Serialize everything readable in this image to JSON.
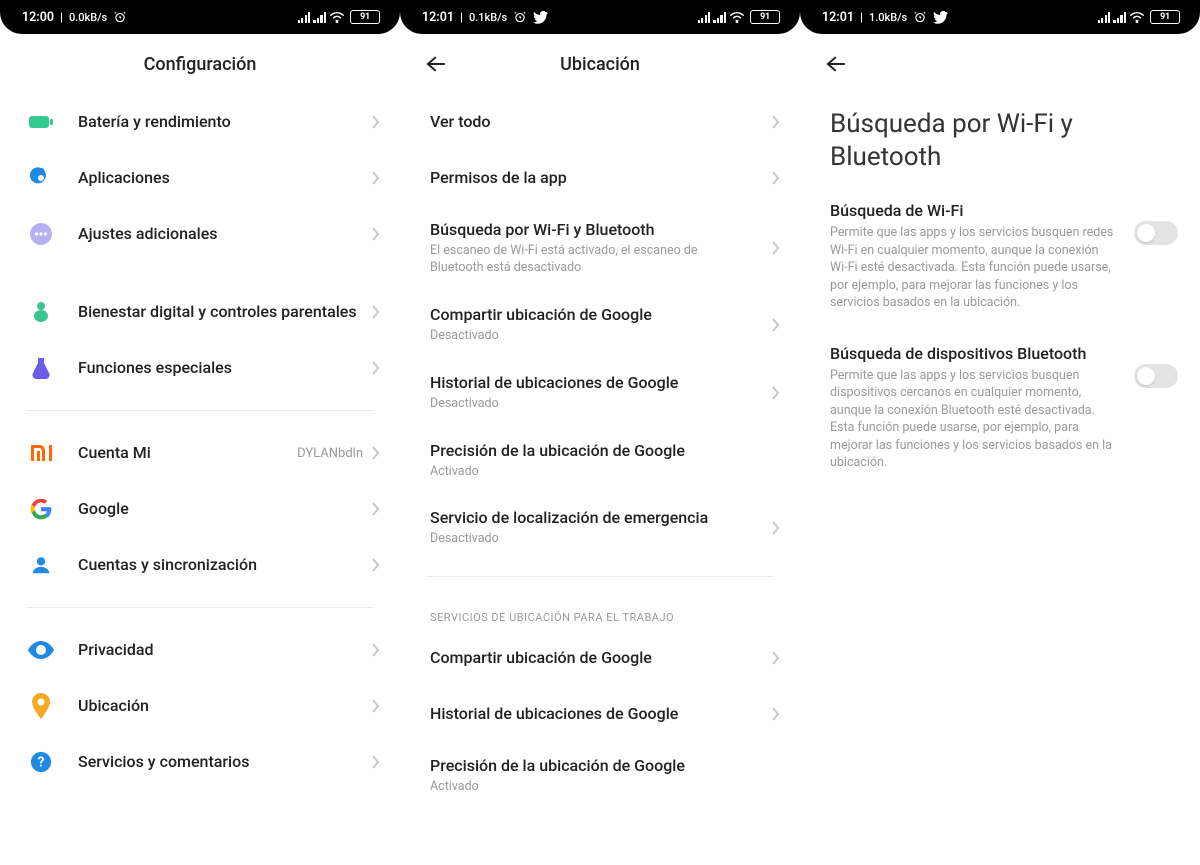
{
  "phones": [
    {
      "status": {
        "time": "12:00",
        "kbs": "0.0kB/s",
        "battery": "91",
        "twitter": false
      },
      "title": "Configuración",
      "groups": [
        {
          "type": "items",
          "items": [
            {
              "icon": "battery",
              "label": "Batería y rendimiento"
            },
            {
              "icon": "apps",
              "label": "Aplicaciones"
            },
            {
              "icon": "dots",
              "label": "Ajustes adicionales"
            }
          ]
        },
        {
          "type": "items",
          "items": [
            {
              "icon": "wellbeing",
              "label": "Bienestar digital y controles parentales"
            },
            {
              "icon": "special",
              "label": "Funciones especiales"
            }
          ]
        },
        {
          "type": "divider"
        },
        {
          "type": "items",
          "items": [
            {
              "icon": "mi",
              "label": "Cuenta Mi",
              "value": "DYLANbdln"
            },
            {
              "icon": "google",
              "label": "Google"
            },
            {
              "icon": "person",
              "label": "Cuentas y sincronización"
            }
          ]
        },
        {
          "type": "divider"
        },
        {
          "type": "items",
          "items": [
            {
              "icon": "eye",
              "label": "Privacidad"
            },
            {
              "icon": "location",
              "label": "Ubicación"
            },
            {
              "icon": "help",
              "label": "Servicios y comentarios"
            }
          ]
        }
      ]
    },
    {
      "status": {
        "time": "12:01",
        "kbs": "0.1kB/s",
        "battery": "91",
        "twitter": true
      },
      "back": true,
      "title": "Ubicación",
      "groups": [
        {
          "type": "plain",
          "items": [
            {
              "label": "Ver todo"
            },
            {
              "label": "Permisos de la app"
            },
            {
              "label": "Búsqueda por Wi-Fi y Bluetooth",
              "sub": "El escaneo de Wi-Fi está activado, el escaneo de Bluetooth está desactivado"
            },
            {
              "label": "Compartir ubicación de Google",
              "sub": "Desactivado"
            },
            {
              "label": "Historial de ubicaciones de Google",
              "sub": "Desactivado"
            },
            {
              "label": "Precisión de la ubicación de Google",
              "sub": "Activado",
              "nochev": true
            },
            {
              "label": "Servicio de localización de emergencia",
              "sub": "Desactivado"
            }
          ]
        },
        {
          "type": "divider"
        },
        {
          "type": "section",
          "label": "SERVICIOS DE UBICACIÓN PARA EL TRABAJO"
        },
        {
          "type": "plain",
          "items": [
            {
              "label": "Compartir ubicación de Google"
            },
            {
              "label": "Historial de ubicaciones de Google"
            },
            {
              "label": "Precisión de la ubicación de Google",
              "sub": "Activado",
              "nochev": true
            }
          ]
        }
      ]
    },
    {
      "status": {
        "time": "12:01",
        "kbs": "1.0kB/s",
        "battery": "91",
        "twitter": true
      },
      "back": true,
      "bigTitle": "Búsqueda por Wi-Fi y Bluetooth",
      "toggles": [
        {
          "label": "Búsqueda de Wi-Fi",
          "sub": "Permite que las apps y los servicios busquen redes Wi-Fi en cualquier momento, aunque la conexión Wi-Fi esté desactivada. Esta función puede usarse, por ejemplo, para mejorar las funciones y los servicios basados en la ubicación.",
          "on": false
        },
        {
          "label": "Búsqueda de dispositivos Bluetooth",
          "sub": "Permite que las apps y los servicios busquen dispositivos cercanos en cualquier momento, aunque la conexión Bluetooth esté desactivada. Esta función puede usarse, por ejemplo, para mejorar las funciones y los servicios basados en la ubicación.",
          "on": false
        }
      ]
    }
  ]
}
